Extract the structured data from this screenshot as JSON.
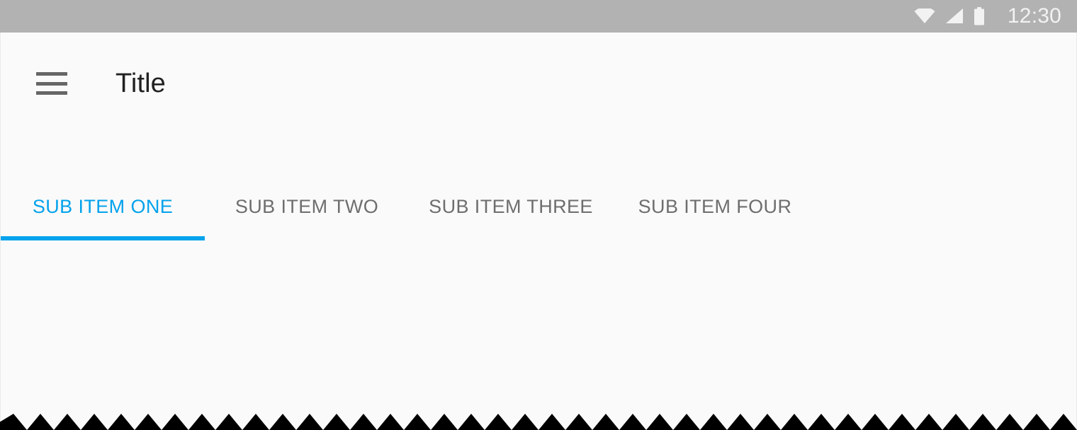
{
  "status_bar": {
    "background_color": "#b2b2b2",
    "clock": "12:30",
    "icons": [
      {
        "name": "wifi-icon",
        "label": "wifi"
      },
      {
        "name": "cellular-signal-icon",
        "label": "signal"
      },
      {
        "name": "battery-icon",
        "label": "battery"
      }
    ]
  },
  "toolbar": {
    "menu_icon": "hamburger-menu-icon",
    "title": "Title",
    "background_color": "#fafafa",
    "title_color": "#212121"
  },
  "tabs": {
    "accent_color": "#03a2ec",
    "inactive_color": "#6e6e6e",
    "active_index": 0,
    "items": [
      {
        "label": "SUB ITEM ONE"
      },
      {
        "label": "SUB ITEM TWO"
      },
      {
        "label": "SUB ITEM THREE"
      },
      {
        "label": "SUB ITEM FOUR"
      }
    ]
  },
  "content": {
    "background_color": "#fafafa",
    "body_text": ""
  },
  "torn_edge": {
    "name": "sawtooth-edge",
    "color": "#000000",
    "tooth_width": 38,
    "tooth_height": 23
  }
}
